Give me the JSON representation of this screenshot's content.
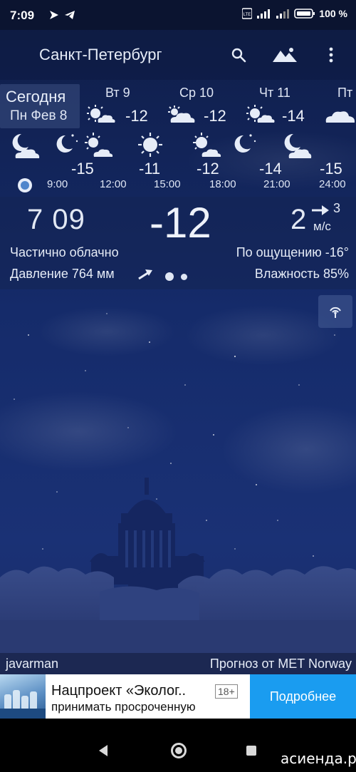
{
  "status_bar": {
    "time": "7:09",
    "battery": "100 %"
  },
  "app_bar": {
    "city": "Санкт-Петербург"
  },
  "today": {
    "label": "Сегодня",
    "date": "Пн Фев 8"
  },
  "days": [
    {
      "name": "Вт 9",
      "temp": "-12",
      "icon": "sun-cloud-icon"
    },
    {
      "name": "Ср 10",
      "temp": "-12",
      "icon": "cloud-sun-icon"
    },
    {
      "name": "Чт 11",
      "temp": "-14",
      "icon": "sun-cloud-icon"
    },
    {
      "name": "Пт",
      "temp": "",
      "icon": "cloud-icon"
    }
  ],
  "hourly": [
    {
      "time": "9:00",
      "temp": "-15",
      "icon": "moon-cloud-icon"
    },
    {
      "time": "12:00",
      "temp": "-11",
      "icon": "sun-cloud-icon"
    },
    {
      "time": "15:00",
      "temp": "-12",
      "icon": "sun-icon"
    },
    {
      "time": "18:00",
      "temp": "-14",
      "icon": "sun-cloud-icon"
    },
    {
      "time": "21:00",
      "temp": "-15",
      "icon": "moon-icon"
    },
    {
      "time": "24:00",
      "temp": "",
      "icon": "moon-cloud-icon"
    }
  ],
  "hourly_extra_icon": "moon-cloud-icon",
  "current": {
    "clock": "7 09",
    "temp": "-12",
    "wind_speed": "2",
    "wind_gust": "3",
    "wind_unit": "м/с",
    "condition": "Частично облачно",
    "feels_like": "По ощущению -16°",
    "pressure": "Давление 764 мм",
    "humidity": "Влажность 85%"
  },
  "credits": {
    "left": "javarman",
    "right": "Прогноз от MET Norway"
  },
  "ad": {
    "title": "Нацпроект «Эколог..",
    "age": "18+",
    "subtitle": "принимать просроченную",
    "cta": "Подробнее"
  },
  "watermark": "асиенда.ру",
  "colors": {
    "sky_dark": "#0f1d47",
    "sky": "#1a3175",
    "accent": "#1a9cf0",
    "now_dot": "#4f86cc"
  }
}
